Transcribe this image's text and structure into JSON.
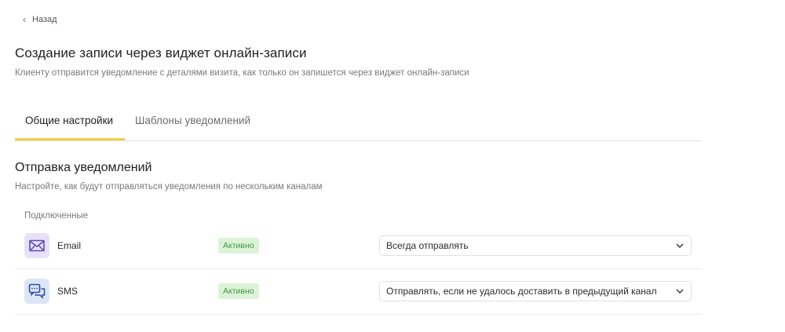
{
  "back": {
    "label": "Назад",
    "icon": "chevron-left-icon"
  },
  "page": {
    "title": "Создание записи через виджет онлайн-записи",
    "subtitle": "Клиенту отправится уведомление с деталями визита, как только он запишется через виджет онлайн-записи"
  },
  "tabs": [
    {
      "label": "Общие настройки",
      "active": true
    },
    {
      "label": "Шаблоны уведомлений",
      "active": false
    }
  ],
  "section": {
    "title": "Отправка уведомлений",
    "subtitle": "Настройте, как будут отправляться уведомления по нескольким каналам",
    "group_label": "Подключенные"
  },
  "channels": [
    {
      "name": "Email",
      "icon": "envelope-icon",
      "status": "Активно",
      "option": "Всегда отправлять"
    },
    {
      "name": "SMS",
      "icon": "chat-bubbles-icon",
      "status": "Активно",
      "option": "Отправлять, если не удалось доставить в предыдущий канал"
    }
  ],
  "colors": {
    "accent": "#f0d24a",
    "badge_bg": "#dcf3d8",
    "badge_text": "#3f9a3f",
    "email_icon_bg": "#e6e1f8",
    "sms_icon_bg": "#dde6f7"
  }
}
